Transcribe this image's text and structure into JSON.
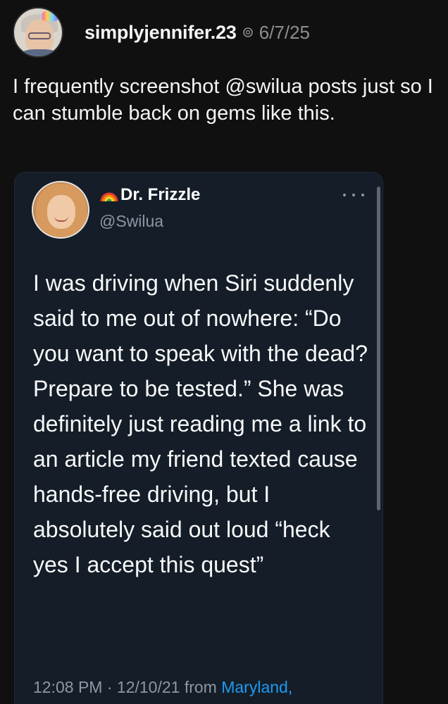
{
  "post": {
    "username": "simplyjennifer.23",
    "date": "6/7/25",
    "text": "I frequently screenshot @swilua posts just so I can stumble back on gems like this.",
    "avatar_icon": "user-avatar-photo",
    "meta_icon": "threads-icon"
  },
  "embedded_tweet": {
    "display_name": "Dr. Frizzle",
    "name_emoji_icon": "rainbow-icon",
    "handle": "@Swilua",
    "text": "I was driving when Siri suddenly said to me out of nowhere: “Do you want to speak with the dead? Prepare to be tested.” She was definitely just reading me a link to an article my friend texted cause hands-free driving, but I absolutely said out loud “heck yes I accept this quest”",
    "time": "12:08 PM",
    "separator": "·",
    "date": "12/10/21",
    "from_label": "from",
    "location": "Maryland,"
  },
  "colors": {
    "background": "#101010",
    "card_background": "#151d28",
    "secondary_text": "#8b98a5",
    "link": "#1d9bf0"
  }
}
